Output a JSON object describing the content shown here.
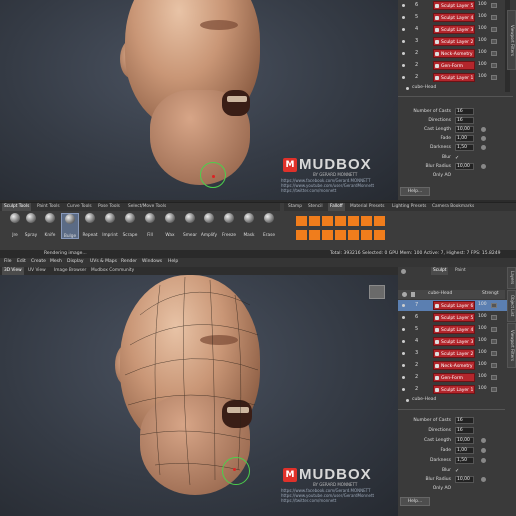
{
  "top_panel": {
    "layers": [
      {
        "num": "6",
        "name": "Sculpt Layer 5",
        "value": "100"
      },
      {
        "num": "5",
        "name": "Sculpt Layer 4",
        "value": "100"
      },
      {
        "num": "4",
        "name": "Sculpt Layer 3",
        "value": "100"
      },
      {
        "num": "3",
        "name": "Sculpt Layer 2",
        "value": "100"
      },
      {
        "num": "2",
        "name": "Neck-Asmetry",
        "value": "100"
      },
      {
        "num": "2",
        "name": "Gen-Form",
        "value": "100"
      },
      {
        "num": "2",
        "name": "Sculpt Layer 1",
        "value": "100"
      }
    ],
    "mesh_name": "cube-Head",
    "props": [
      {
        "label": "Number of Casts",
        "value": "16"
      },
      {
        "label": "Directions",
        "value": "16"
      },
      {
        "label": "Cast Length",
        "value": "10,00"
      },
      {
        "label": "Fade",
        "value": "1,00"
      },
      {
        "label": "Darkness",
        "value": "1,50"
      }
    ],
    "blur_label": "Blur",
    "blur_radius_label": "Blur Radius",
    "blur_radius_value": "10,00",
    "only_ao_label": "Only AO",
    "help_label": "Help..."
  },
  "tool_tabs": [
    "Sculpt Tools",
    "Paint Tools",
    "Curve Tools",
    "Pose Tools",
    "Select/Move Tools"
  ],
  "tools": [
    "Jre",
    "Spray",
    "Knife",
    "Bulge",
    "Repeat",
    "Imprint",
    "Scrape",
    "Fill",
    "Wax",
    "Smear",
    "Amplify",
    "Freeze",
    "Mask",
    "Erase"
  ],
  "stamp_tabs": [
    "Stamp",
    "Stencil",
    "Falloff",
    "Material Presets",
    "Lighting Presets",
    "Camera Bookmarks"
  ],
  "status": {
    "left": "Rendering image...",
    "right": "Total: 393216  Selected: 0  GPU Mem: 100  Active: 7, Highest: 7  FPS: 15.8249"
  },
  "menu": [
    "File",
    "Edit",
    "Create",
    "Mesh",
    "Display",
    "UVs & Maps",
    "Render",
    "Windows",
    "Help"
  ],
  "view_tabs": [
    "3D View",
    "UV View",
    "Image Browser",
    "Mudbox Community"
  ],
  "bottom_panel": {
    "tabs": [
      "Sculpt",
      "Paint"
    ],
    "header_mesh": "cube-Head",
    "header_strength": "Strengt",
    "selected_layer": {
      "num": "7",
      "name": "Sculpt Layer 6",
      "value": "100"
    },
    "layers": [
      {
        "num": "6",
        "name": "Sculpt Layer 5",
        "value": "100"
      },
      {
        "num": "5",
        "name": "Sculpt Layer 4",
        "value": "100"
      },
      {
        "num": "4",
        "name": "Sculpt Layer 3",
        "value": "100"
      },
      {
        "num": "3",
        "name": "Sculpt Layer 2",
        "value": "100"
      },
      {
        "num": "2",
        "name": "Neck-Asmetry",
        "value": "100"
      },
      {
        "num": "2",
        "name": "Gen-Form",
        "value": "100"
      },
      {
        "num": "2",
        "name": "Sculpt Layer 1",
        "value": "100"
      }
    ],
    "mesh_name": "cube-Head",
    "props": [
      {
        "label": "Number of Casts",
        "value": "16"
      },
      {
        "label": "Directions",
        "value": "16"
      },
      {
        "label": "Cast Length",
        "value": "10,00"
      },
      {
        "label": "Fade",
        "value": "1,00"
      },
      {
        "label": "Darkness",
        "value": "1,50"
      }
    ],
    "blur_label": "Blur",
    "blur_radius_label": "Blur Radius",
    "blur_radius_value": "10,00",
    "only_ao_label": "Only AO",
    "help_label": "Help..."
  },
  "side_tabs": [
    "Object List",
    "Viewport Filters"
  ],
  "side_tab_layers": "Layers",
  "watermark": {
    "word": "MUDBOX",
    "by": "BY GERARD MONNETT",
    "url1": "https://www.facebook.com/Gerard.MONNETT",
    "url2": "https://www.youtube.com/user/GerardMonnett",
    "url3": "https://twitter.com/monnett"
  },
  "colors": {
    "layer_red": "#b3262c",
    "accent_orange": "#f07d1c",
    "brush_green": "#4cd04c"
  }
}
